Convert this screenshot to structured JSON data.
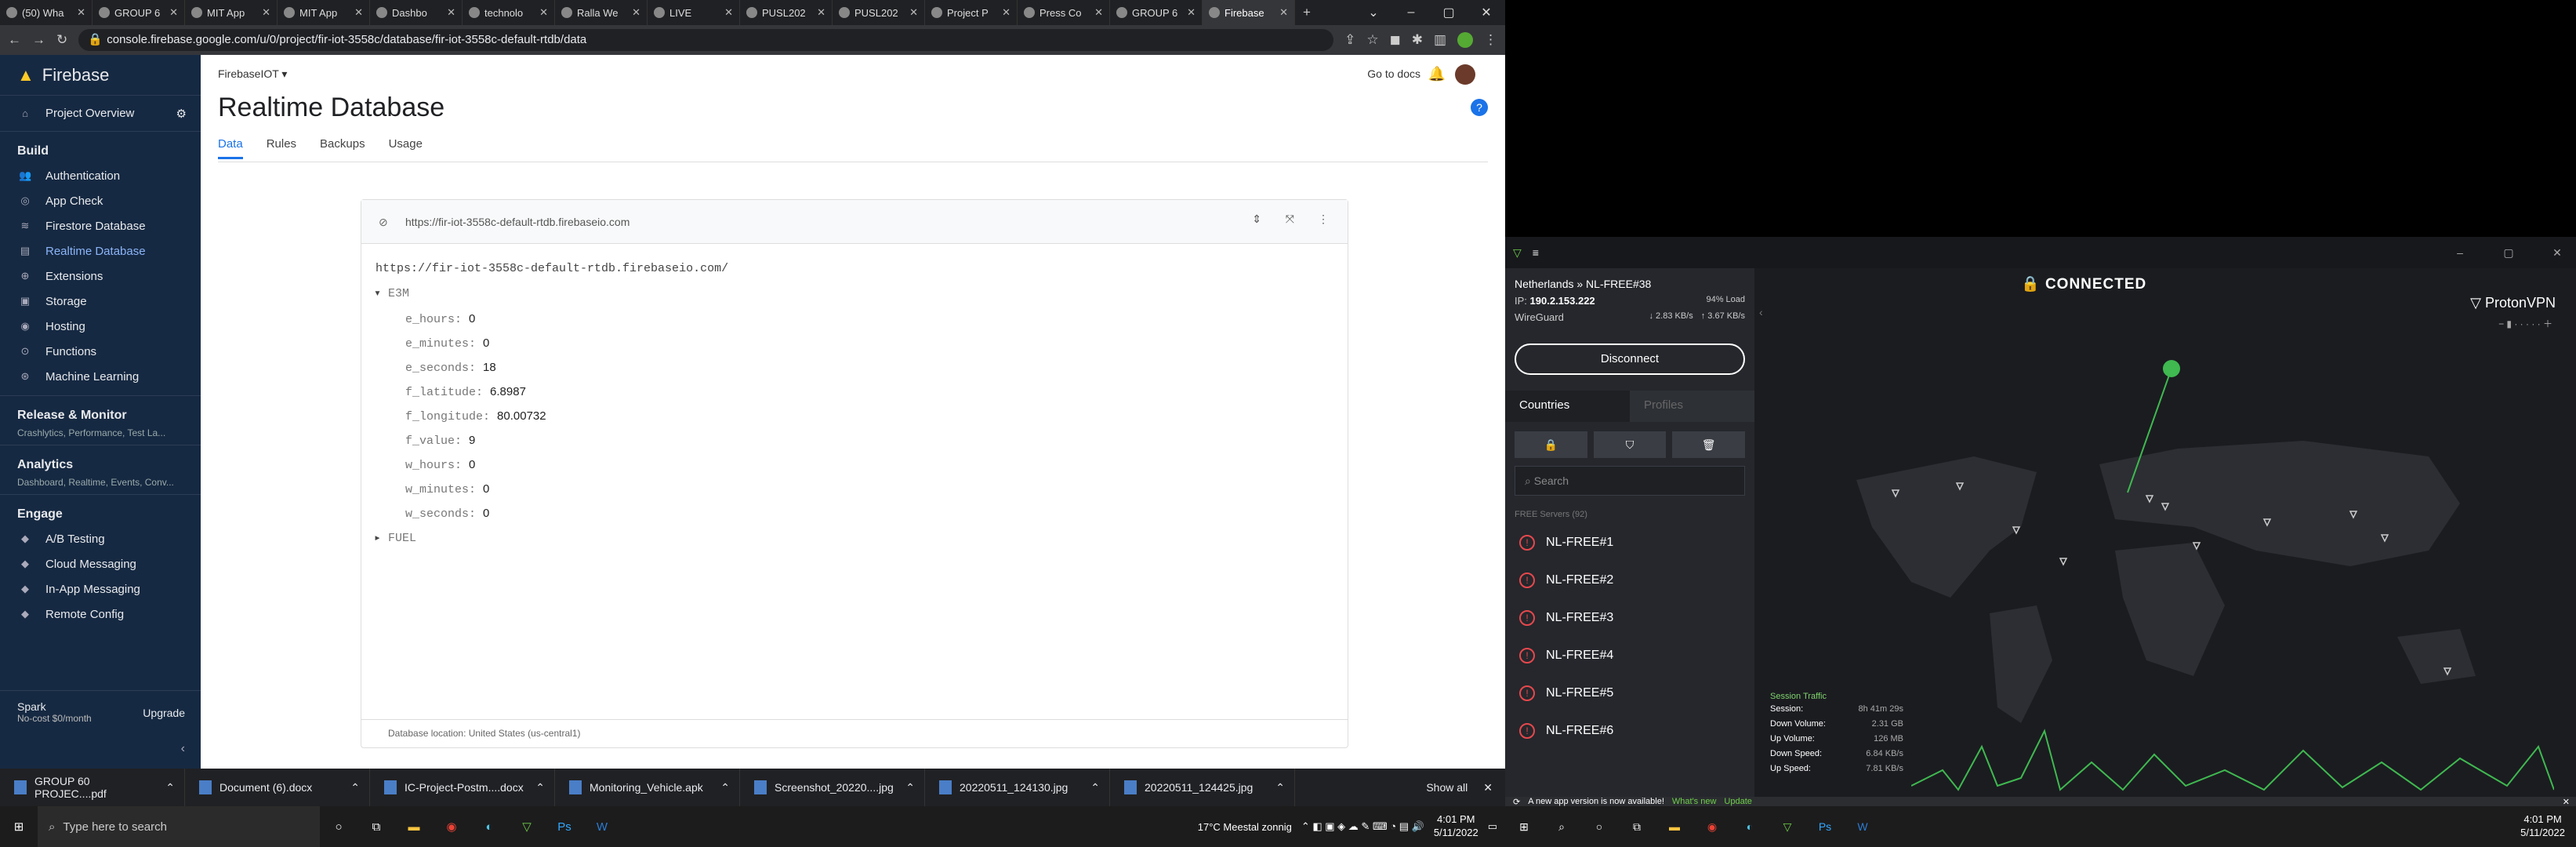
{
  "browser": {
    "tabs": [
      "(50) Wha",
      "GROUP 6",
      "MIT App",
      "MIT App",
      "Dashbo",
      "technolo",
      "Ralla We",
      "LIVE",
      "PUSL202",
      "PUSL202",
      "Project P",
      "Press Co",
      "GROUP 6",
      "Firebase"
    ],
    "url": "console.firebase.google.com/u/0/project/fir-iot-3558c/database/fir-iot-3558c-default-rtdb/data"
  },
  "firebase": {
    "brand": "Firebase",
    "project_overview": "Project Overview",
    "build_label": "Build",
    "build_items": [
      "Authentication",
      "App Check",
      "Firestore Database",
      "Realtime Database",
      "Extensions",
      "Storage",
      "Hosting",
      "Functions",
      "Machine Learning"
    ],
    "release_title": "Release & Monitor",
    "release_sub": "Crashlytics, Performance, Test La...",
    "analytics_title": "Analytics",
    "analytics_sub": "Dashboard, Realtime, Events, Conv...",
    "engage_title": "Engage",
    "engage_items": [
      "A/B Testing",
      "Cloud Messaging",
      "In-App Messaging",
      "Remote Config"
    ],
    "plan_name": "Spark",
    "plan_price": "No-cost $0/month",
    "upgrade": "Upgrade",
    "project_name": "FirebaseIOT",
    "go_to_docs": "Go to docs",
    "page_title": "Realtime Database",
    "tabs": [
      "Data",
      "Rules",
      "Backups",
      "Usage"
    ],
    "db_url": "https://fir-iot-3558c-default-rtdb.firebaseio.com",
    "root_url": "https://fir-iot-3558c-default-rtdb.firebaseio.com/",
    "node": "E3M",
    "fields": [
      {
        "key": "e_hours",
        "value": "0"
      },
      {
        "key": "e_minutes",
        "value": "0"
      },
      {
        "key": "e_seconds",
        "value": "18"
      },
      {
        "key": "f_latitude",
        "value": "6.8987"
      },
      {
        "key": "f_longitude",
        "value": "80.00732"
      },
      {
        "key": "f_value",
        "value": "9"
      },
      {
        "key": "w_hours",
        "value": "0"
      },
      {
        "key": "w_minutes",
        "value": "0"
      },
      {
        "key": "w_seconds",
        "value": "0"
      }
    ],
    "node2": "FUEL",
    "location": "Database location: United States (us-central1)"
  },
  "downloads": [
    "GROUP 60 PROJEC....pdf",
    "Document (6).docx",
    "IC-Project-Postm....docx",
    "Monitoring_Vehicle.apk",
    "Screenshot_20220....jpg",
    "20220511_124130.jpg",
    "20220511_124425.jpg"
  ],
  "show_all": "Show all",
  "taskbar": {
    "search": "Type here to search",
    "weather": "17°C  Meestal zonnig",
    "time": "4:01 PM",
    "date": "5/11/2022"
  },
  "vpn": {
    "server": "Netherlands » NL-FREE#38",
    "ip_label": "IP:",
    "ip": "190.2.153.222",
    "load": "94% Load",
    "protocol": "WireGuard",
    "down_rate": "2.83 KB/s",
    "up_rate": "3.67 KB/s",
    "disconnect": "Disconnect",
    "tab_countries": "Countries",
    "tab_profiles": "Profiles",
    "search": "Search",
    "free_servers": "FREE Servers (92)",
    "servers": [
      "NL-FREE#1",
      "NL-FREE#2",
      "NL-FREE#3",
      "NL-FREE#4",
      "NL-FREE#5",
      "NL-FREE#6"
    ],
    "status": "CONNECTED",
    "brand": "ProtonVPN",
    "traffic_title": "Session Traffic",
    "traffic": [
      {
        "label": "Session:",
        "value": "8h 41m 29s"
      },
      {
        "label": "Down Volume:",
        "value": "2.31 GB"
      },
      {
        "label": "Up Volume:",
        "value": "126 MB"
      },
      {
        "label": "Down Speed:",
        "value": "6.84 KB/s"
      },
      {
        "label": "Up Speed:",
        "value": "7.81 KB/s"
      }
    ],
    "update_text": "A new app version is now available!",
    "whats_new": "What's new",
    "update": "Update"
  },
  "right_taskbar": {
    "time": "4:01 PM",
    "date": "5/11/2022"
  }
}
